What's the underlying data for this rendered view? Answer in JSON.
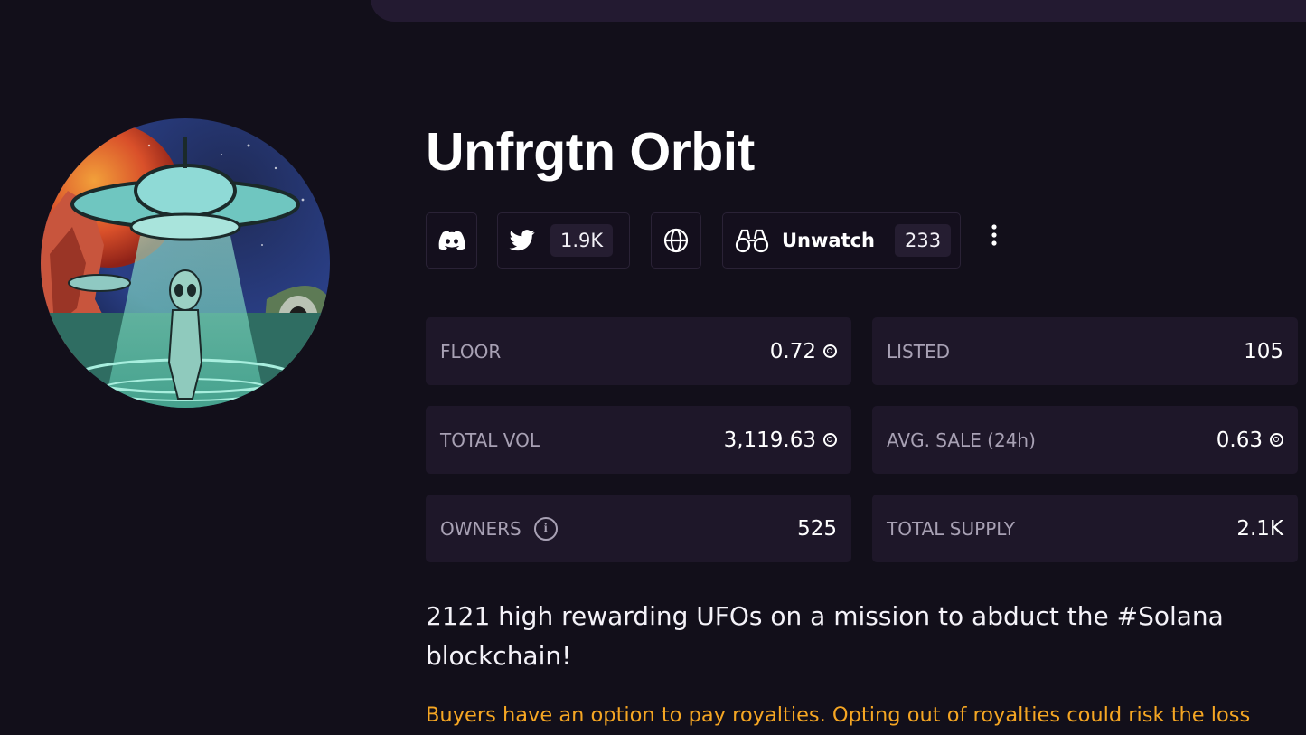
{
  "collection": {
    "name": "Unfrgtn Orbit",
    "description": "2121 high rewarding UFOs on a mission to abduct the #Solana blockchain!",
    "royalty_notice": "Buyers have an option to pay royalties. Opting out of royalties could risk the loss"
  },
  "socials": {
    "discord_icon": "discord-icon",
    "twitter_icon": "twitter-icon",
    "twitter_followers": "1.9K",
    "website_icon": "globe-icon",
    "watch_icon": "binoculars-icon",
    "watch_label": "Unwatch",
    "watch_count": "233",
    "more_icon": "more-vertical-icon"
  },
  "stats": {
    "floor": {
      "label": "FLOOR",
      "value": "0.72"
    },
    "listed": {
      "label": "LISTED",
      "value": "105"
    },
    "total_vol": {
      "label": "TOTAL VOL",
      "value": "3,119.63"
    },
    "avg_sale": {
      "label": "AVG. SALE (24h)",
      "value": "0.63"
    },
    "owners": {
      "label": "OWNERS",
      "value": "525"
    },
    "total_supply": {
      "label": "TOTAL SUPPLY",
      "value": "2.1K"
    }
  },
  "colors": {
    "background": "#120f1a",
    "card": "#1e1729",
    "warning": "#f5a623",
    "muted_text": "#a8a1b4"
  }
}
